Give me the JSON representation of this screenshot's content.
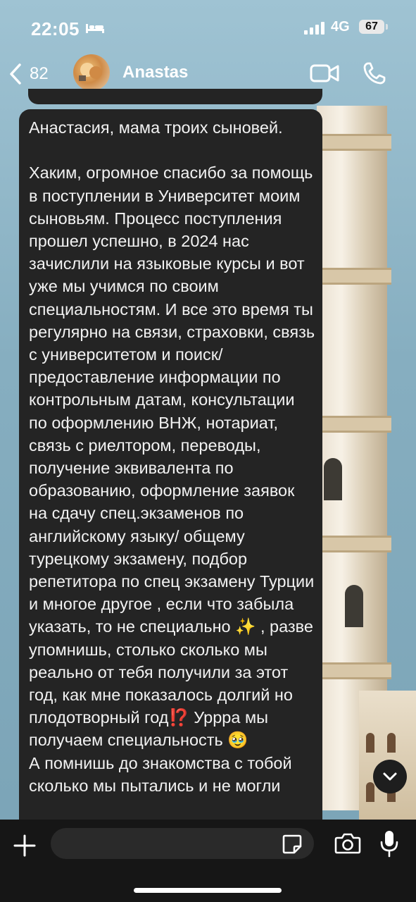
{
  "status_bar": {
    "time": "22:05",
    "network": "4G",
    "battery": "67",
    "icons": [
      "bed-icon",
      "signal-icon",
      "battery-icon"
    ]
  },
  "header": {
    "back_count": "82",
    "contact_name": "Anastas",
    "icons": [
      "back-chevron-icon",
      "video-call-icon",
      "phone-icon"
    ]
  },
  "message": {
    "text": "Анастасия, мама троих сыновей.\n\nХаким, огромное спасибо за помощь в поступлении в Университет моим сыновьям. Процесс поступления прошел успешно, в 2024 нас зачислили на языковые курсы и вот уже мы учимся по своим специальностям. И все это время ты регулярно на связи, страховки, связь с университетом и поиск/ предоставление информации по контрольным датам, консультации по оформлению ВНЖ, нотариат, связь с риелтором, переводы, получение эквивалента по образованию, оформление заявок на сдачу спец.экзаменов по английскому языку/ общему турецкому экзамену, подбор репетитора по спец экзамену Турции и многое другое , если что забыла указать, то не специально ✨ , разве упомнишь, столько сколько мы реально от тебя получили за этот год, как мне показалось долгий но плодотворный год⁉️ Уррра мы получаем специальность 🥹\nА помнишь до знакомства с тобой сколько мы пытались и не могли"
  },
  "input_bar": {
    "placeholder": "",
    "icons": [
      "plus-icon",
      "sticker-icon",
      "camera-icon",
      "microphone-icon"
    ]
  },
  "colors": {
    "bubble": "#242424",
    "input_bar": "#161616",
    "text": "#f2f2f2"
  }
}
